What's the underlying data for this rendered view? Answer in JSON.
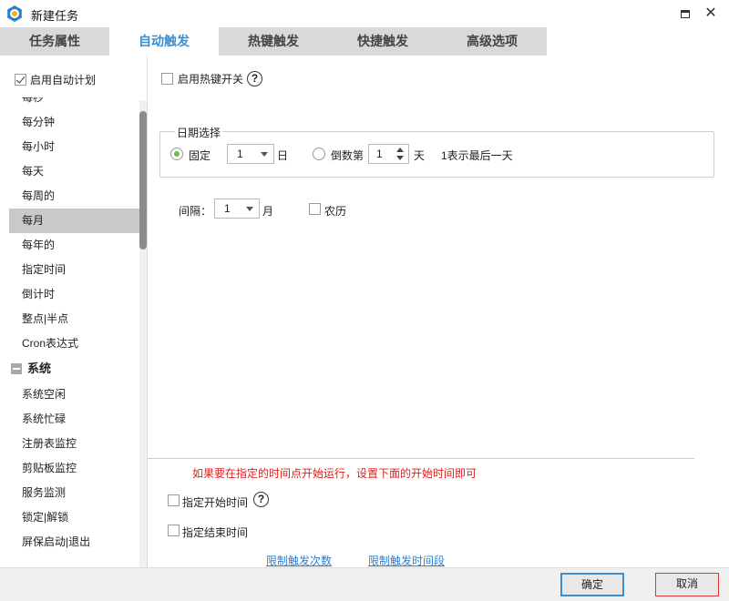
{
  "window": {
    "title": "新建任务"
  },
  "tabs": [
    {
      "label": "任务属性",
      "active": false
    },
    {
      "label": "自动触发",
      "active": true
    },
    {
      "label": "热键触发",
      "active": false
    },
    {
      "label": "快捷触发",
      "active": false
    },
    {
      "label": "高级选项",
      "active": false
    }
  ],
  "left": {
    "auto_plan_label": "启用自动计划",
    "auto_plan_checked": true,
    "items": [
      "每秒",
      "每分钟",
      "每小时",
      "每天",
      "每周的",
      "每月",
      "每年的",
      "指定时间",
      "倒计时",
      "整点|半点",
      "Cron表达式"
    ],
    "selected": "每月",
    "group_label": "系统",
    "group_items": [
      "系统空闲",
      "系统忙碌",
      "注册表监控",
      "剪贴板监控",
      "服务监测",
      "锁定|解锁",
      "屏保启动|退出"
    ]
  },
  "right": {
    "hotkey_label": "启用热键开关",
    "help_glyph": "?",
    "date_group_label": "日期选择",
    "fixed_label": "固定",
    "fixed_value": "1",
    "day_unit": "日",
    "countdown_label": "倒数第",
    "countdown_value": "1",
    "countdown_unit": "天",
    "countdown_hint": "1表示最后一天",
    "interval_label": "间隔：",
    "interval_value": "1",
    "interval_unit": "月",
    "lunar_label": "农历",
    "warning": "如果要在指定的时间点开始运行，设置下面的开始时间即可",
    "start_time_label": "指定开始时间",
    "end_time_label": "指定结束时间",
    "limit_count_link": "限制触发次数",
    "limit_period_link": "限制触发时间段"
  },
  "buttons": {
    "ok": "确定",
    "cancel": "取消"
  },
  "colors": {
    "accent": "#3b8ed0",
    "warning": "#e0201d",
    "radio_checked": "#6cc04a",
    "cancel_border": "#d43b3b"
  }
}
